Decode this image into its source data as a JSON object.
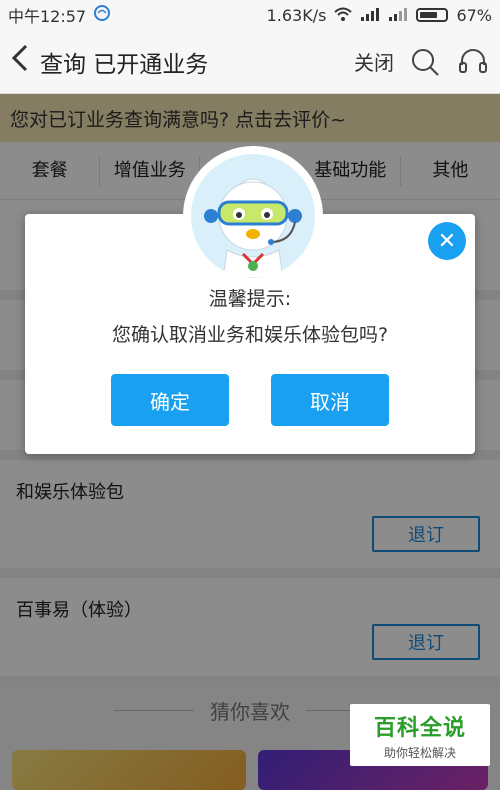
{
  "status_bar": {
    "time": "中午12:57",
    "network_speed": "1.63K/s",
    "battery": "67%"
  },
  "nav": {
    "title": "查询 已开通业务",
    "close_label": "关闭"
  },
  "banner": {
    "text": "您对已订业务查询满意吗? 点击去评价~"
  },
  "tabs": [
    {
      "label": "套餐"
    },
    {
      "label": "增值业务"
    },
    {
      "label": ""
    },
    {
      "label": "基础功能"
    },
    {
      "label": "其他"
    }
  ],
  "services": [
    {
      "name": "和娱乐体验包",
      "action": "退订"
    },
    {
      "name": "百事易（体验）",
      "action": "退订"
    }
  ],
  "guess": {
    "title": "猜你喜欢"
  },
  "dialog": {
    "title": "温馨提示:",
    "message": "您确认取消业务和娱乐体验包吗?",
    "confirm_label": "确定",
    "cancel_label": "取消"
  },
  "watermark": {
    "line1": "百科全说",
    "line2": "助你轻松解决"
  },
  "colors": {
    "accent": "#1aa0f0",
    "link": "#1e88d9",
    "banner_bg": "#f3e4b3"
  },
  "icons": [
    "back-arrow-icon",
    "search-icon",
    "headset-icon",
    "wifi-icon",
    "signal-icon",
    "battery-icon",
    "close-icon"
  ]
}
